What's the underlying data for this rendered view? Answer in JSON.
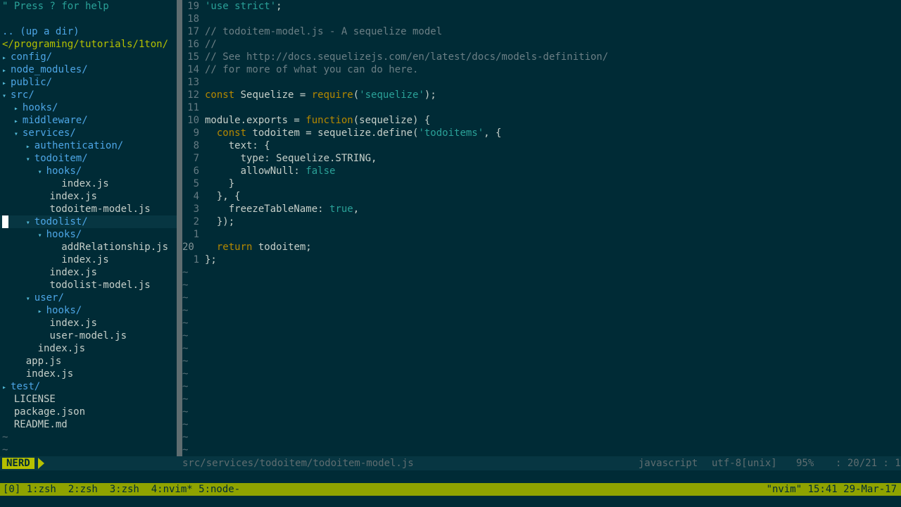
{
  "tree": {
    "help": "\" Press ? for help",
    "up_dir": ".. (up a dir)",
    "root": "</programing/tutorials/1ton/",
    "items": [
      {
        "indent": 0,
        "type": "dir",
        "open": false,
        "label": "config/"
      },
      {
        "indent": 0,
        "type": "dir",
        "open": false,
        "label": "node_modules/"
      },
      {
        "indent": 0,
        "type": "dir",
        "open": false,
        "label": "public/"
      },
      {
        "indent": 0,
        "type": "dir",
        "open": true,
        "label": "src/"
      },
      {
        "indent": 1,
        "type": "dir",
        "open": false,
        "label": "hooks/"
      },
      {
        "indent": 1,
        "type": "dir",
        "open": false,
        "label": "middleware/"
      },
      {
        "indent": 1,
        "type": "dir",
        "open": true,
        "label": "services/"
      },
      {
        "indent": 2,
        "type": "dir",
        "open": false,
        "label": "authentication/"
      },
      {
        "indent": 2,
        "type": "dir",
        "open": true,
        "label": "todoitem/"
      },
      {
        "indent": 3,
        "type": "dir",
        "open": true,
        "label": "hooks/"
      },
      {
        "indent": 4,
        "type": "file",
        "label": "index.js"
      },
      {
        "indent": 3,
        "type": "file",
        "label": "index.js"
      },
      {
        "indent": 3,
        "type": "file",
        "label": "todoitem-model.js"
      },
      {
        "indent": 2,
        "type": "dir",
        "open": true,
        "label": "todolist/",
        "cursor": true
      },
      {
        "indent": 3,
        "type": "dir",
        "open": true,
        "label": "hooks/"
      },
      {
        "indent": 4,
        "type": "file",
        "label": "addRelationship.js"
      },
      {
        "indent": 4,
        "type": "file",
        "label": "index.js"
      },
      {
        "indent": 3,
        "type": "file",
        "label": "index.js"
      },
      {
        "indent": 3,
        "type": "file",
        "label": "todolist-model.js"
      },
      {
        "indent": 2,
        "type": "dir",
        "open": true,
        "label": "user/"
      },
      {
        "indent": 3,
        "type": "dir",
        "open": false,
        "label": "hooks/"
      },
      {
        "indent": 3,
        "type": "file",
        "label": "index.js"
      },
      {
        "indent": 3,
        "type": "file",
        "label": "user-model.js"
      },
      {
        "indent": 2,
        "type": "file",
        "label": "index.js"
      },
      {
        "indent": 1,
        "type": "file",
        "label": "app.js"
      },
      {
        "indent": 1,
        "type": "file",
        "label": "index.js"
      },
      {
        "indent": 0,
        "type": "dir",
        "open": false,
        "label": "test/"
      },
      {
        "indent": 0,
        "type": "file",
        "label": "LICENSE"
      },
      {
        "indent": 0,
        "type": "file",
        "label": "package.json"
      },
      {
        "indent": 0,
        "type": "file",
        "label": "README.md"
      }
    ],
    "tildes": 2
  },
  "editor": {
    "lines": [
      {
        "num": "19",
        "cur": false,
        "tokens": [
          [
            "s",
            "'use strict'"
          ],
          [
            "v",
            ";"
          ]
        ]
      },
      {
        "num": "18",
        "cur": false,
        "tokens": []
      },
      {
        "num": "17",
        "cur": false,
        "tokens": [
          [
            "c",
            "// todoitem-model.js - A sequelize model"
          ]
        ]
      },
      {
        "num": "16",
        "cur": false,
        "tokens": [
          [
            "c",
            "//"
          ]
        ]
      },
      {
        "num": "15",
        "cur": false,
        "tokens": [
          [
            "c",
            "// See http://docs.sequelizejs.com/en/latest/docs/models-definition/"
          ]
        ]
      },
      {
        "num": "14",
        "cur": false,
        "tokens": [
          [
            "c",
            "// for more of what you can do here."
          ]
        ]
      },
      {
        "num": "13",
        "cur": false,
        "tokens": []
      },
      {
        "num": "12",
        "cur": false,
        "tokens": [
          [
            "k",
            "const"
          ],
          [
            "v",
            " Sequelize = "
          ],
          [
            "k",
            "require"
          ],
          [
            "v",
            "("
          ],
          [
            "s",
            "'sequelize'"
          ],
          [
            "v",
            ");"
          ]
        ]
      },
      {
        "num": "11",
        "cur": false,
        "tokens": []
      },
      {
        "num": "10",
        "cur": false,
        "tokens": [
          [
            "v",
            "module.exports = "
          ],
          [
            "k",
            "function"
          ],
          [
            "v",
            "(sequelize) {"
          ]
        ]
      },
      {
        "num": "9",
        "cur": false,
        "tokens": [
          [
            "v",
            "  "
          ],
          [
            "k",
            "const"
          ],
          [
            "v",
            " todoitem = sequelize.define("
          ],
          [
            "s",
            "'todoitems'"
          ],
          [
            "v",
            ", {"
          ]
        ]
      },
      {
        "num": "8",
        "cur": false,
        "tokens": [
          [
            "v",
            "    text: {"
          ]
        ]
      },
      {
        "num": "7",
        "cur": false,
        "tokens": [
          [
            "v",
            "      type: Sequelize.STRING,"
          ]
        ]
      },
      {
        "num": "6",
        "cur": false,
        "tokens": [
          [
            "v",
            "      allowNull: "
          ],
          [
            "bool",
            "false"
          ]
        ]
      },
      {
        "num": "5",
        "cur": false,
        "tokens": [
          [
            "v",
            "    }"
          ]
        ]
      },
      {
        "num": "4",
        "cur": false,
        "tokens": [
          [
            "v",
            "  }, {"
          ]
        ]
      },
      {
        "num": "3",
        "cur": false,
        "tokens": [
          [
            "v",
            "    freezeTableName: "
          ],
          [
            "bool",
            "true"
          ],
          [
            "v",
            ","
          ]
        ]
      },
      {
        "num": "2",
        "cur": false,
        "tokens": [
          [
            "v",
            "  });"
          ]
        ]
      },
      {
        "num": "1",
        "cur": false,
        "tokens": []
      },
      {
        "num": "20",
        "cur": true,
        "tokens": [
          [
            "v",
            "  "
          ],
          [
            "k",
            "return"
          ],
          [
            "v",
            " todoitem;"
          ]
        ]
      },
      {
        "num": "1",
        "cur": false,
        "tokens": [
          [
            "v",
            "};"
          ]
        ]
      }
    ],
    "tildes": 15
  },
  "status": {
    "mode": "NERD",
    "path": "src/services/todoitem/todoitem-model.js",
    "filetype": "javascript",
    "encoding": "utf-8[unix]",
    "percent": "95%",
    "position": ":  20/21 :  1"
  },
  "tmux": {
    "windows": "[0] 1:zsh  2:zsh  3:zsh  4:nvim* 5:node-",
    "right": "\"nvim\" 15:41 29-Mar-17"
  },
  "colors": {
    "background": "#002b36",
    "directory": "#4da6e6",
    "keyword": "#b58900",
    "string": "#2aa198",
    "tmux_bar": "#8fa300",
    "mode_badge": "#b5c000"
  }
}
